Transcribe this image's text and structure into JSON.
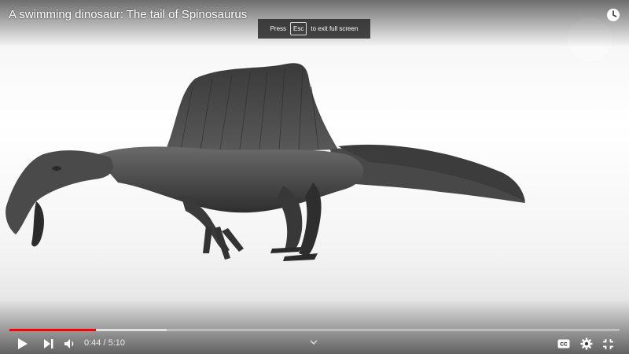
{
  "video": {
    "title": "A swimming dinosaur: The tail of Spinosaurus",
    "progress_fraction": 0.1419,
    "buffered_fraction": 0.258
  },
  "fullscreen_banner": {
    "press": "Press",
    "key": "Esc",
    "suffix": "to exit full screen"
  },
  "controls": {
    "current_time": "0:44",
    "separator": " / ",
    "duration": "5:10",
    "icons": [
      "play-icon",
      "next-icon",
      "volume-icon",
      "chevron-down-icon",
      "captions-icon",
      "settings-icon",
      "exit-fullscreen-icon",
      "watch-later-icon"
    ]
  },
  "colors": {
    "progress": "#ff0000",
    "icon": "#ffffff"
  }
}
